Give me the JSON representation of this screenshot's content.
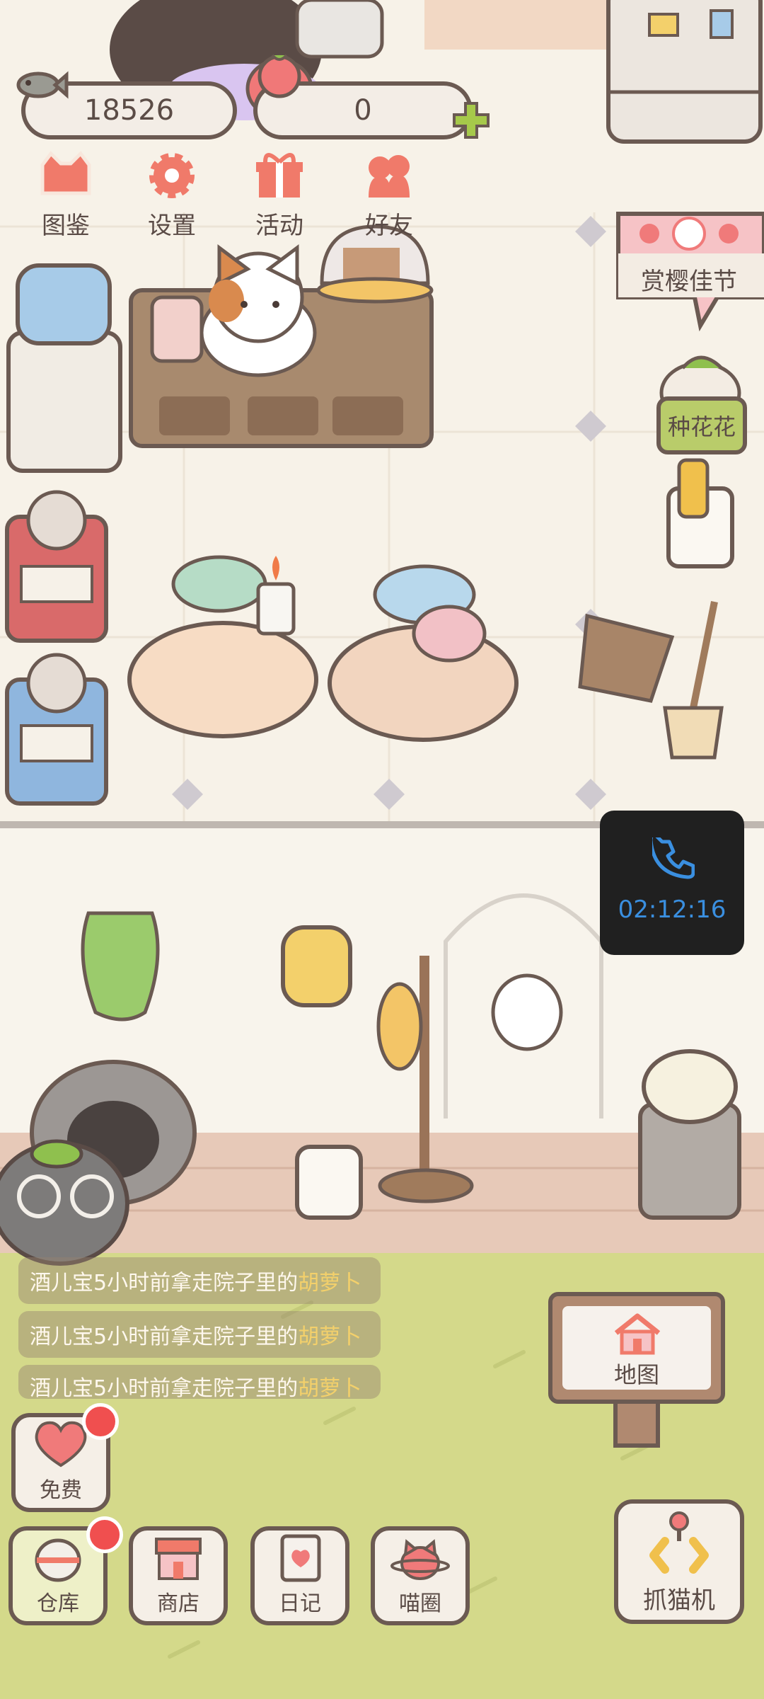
{
  "hud": {
    "coins": "18526",
    "gems": "0"
  },
  "top_menu": [
    {
      "label": "图鉴",
      "icon": "cat-face-icon"
    },
    {
      "label": "设置",
      "icon": "gear-icon"
    },
    {
      "label": "活动",
      "icon": "gift-icon"
    },
    {
      "label": "好友",
      "icon": "friends-icon"
    }
  ],
  "event_banner": {
    "label": "赏樱佳节"
  },
  "plant_tag": {
    "label": "种花花"
  },
  "call": {
    "timer": "02:12:16",
    "icon": "phone-icon"
  },
  "feed": [
    {
      "prefix": "酒儿宝5小时前拿走院子里的",
      "item": "胡萝卜"
    },
    {
      "prefix": "酒儿宝5小时前拿走院子里的",
      "item": "胡萝卜"
    },
    {
      "prefix": "酒儿宝5小时前拿走院子里的",
      "item": "胡萝卜"
    }
  ],
  "map_sign": {
    "label": "地图",
    "icon": "house-icon"
  },
  "free_button": {
    "label": "免费",
    "icon": "heart-icon"
  },
  "bottom_nav": [
    {
      "label": "仓库",
      "icon": "storage-icon"
    },
    {
      "label": "商店",
      "icon": "shop-icon"
    },
    {
      "label": "日记",
      "icon": "diary-icon"
    },
    {
      "label": "喵圈",
      "icon": "cat-planet-icon"
    }
  ],
  "claw_button": {
    "label": "抓猫机",
    "icon": "claw-icon"
  },
  "colors": {
    "accent_red": "#f04f4f",
    "timer_blue": "#3a8fe0",
    "grass": "#d4d98a"
  }
}
